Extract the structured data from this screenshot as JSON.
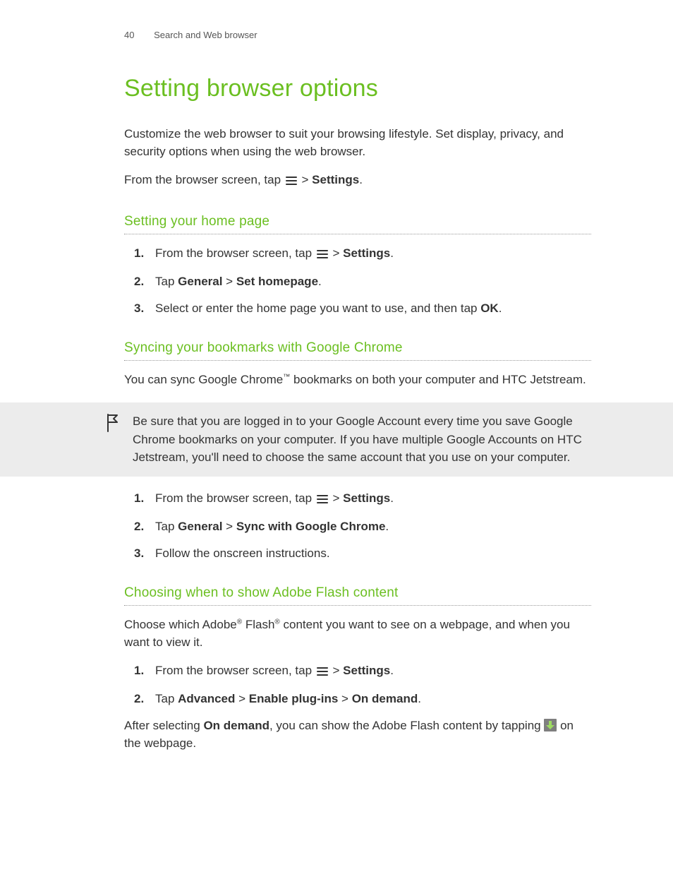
{
  "header": {
    "page_number": "40",
    "section": "Search and Web browser"
  },
  "title": "Setting browser options",
  "intro": "Customize the web browser to suit your browsing lifestyle. Set display, privacy, and security options when using the web browser.",
  "from_prefix": "From the browser screen, tap ",
  "gt": " > ",
  "settings_word": "Settings",
  "period": ".",
  "s1": {
    "heading": "Setting your home page",
    "steps": {
      "n1": "1.",
      "t1a": "From the browser screen, tap ",
      "t1b": "Settings",
      "n2": "2.",
      "t2a": "Tap ",
      "t2b": "General",
      "t2c": "Set homepage",
      "n3": "3.",
      "t3a": "Select or enter the home page you want to use, and then tap ",
      "t3b": "OK"
    }
  },
  "s2": {
    "heading": "Syncing your bookmarks with Google Chrome",
    "para_a": "You can sync Google Chrome",
    "tm": "™",
    "para_b": " bookmarks on both your computer and HTC Jetstream.",
    "note": "Be sure that you are logged in to your Google Account every time you save Google Chrome bookmarks on your computer. If you have multiple Google Accounts on HTC Jetstream, you'll need to choose the same account that you use on your computer.",
    "steps": {
      "n1": "1.",
      "t1a": "From the browser screen, tap ",
      "t1b": "Settings",
      "n2": "2.",
      "t2a": "Tap ",
      "t2b": "General",
      "t2c": "Sync with Google Chrome",
      "n3": "3.",
      "t3": "Follow the onscreen instructions."
    }
  },
  "s3": {
    "heading": "Choosing when to show Adobe Flash content",
    "para_a": "Choose which Adobe",
    "reg": "®",
    "para_b": " Flash",
    "para_c": " content you want to see on a webpage, and when you want to view it.",
    "steps": {
      "n1": "1.",
      "t1a": "From the browser screen, tap ",
      "t1b": "Settings",
      "n2": "2.",
      "t2a": "Tap ",
      "t2b": "Advanced",
      "t2c": "Enable plug-ins",
      "t2d": "On demand"
    },
    "after_a": "After selecting ",
    "after_b": "On demand",
    "after_c": ", you can show the Adobe Flash content by tapping ",
    "after_d": " on the webpage."
  }
}
